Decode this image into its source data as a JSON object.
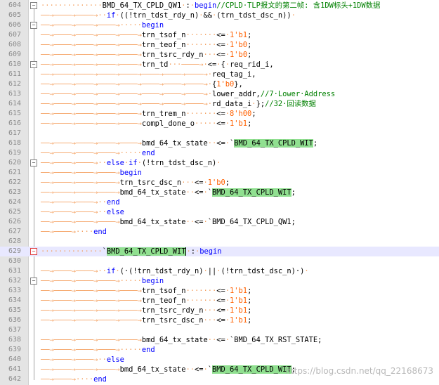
{
  "editor": {
    "watermark": "https://blog.csdn.net/qq_22168673",
    "lines": [
      {
        "n": "604",
        "fold": "minus",
        "segs": [
          [
            "ws",
            "··············"
          ],
          [
            "t",
            "BMD_64_TX_CPLD_QW1"
          ],
          [
            "ws",
            "·"
          ],
          [
            "op",
            ":"
          ],
          [
            "ws",
            "·"
          ],
          [
            "kw",
            "begin"
          ],
          [
            "cmt",
            "//CPLD·TLP报文的第二帧: 含1DW标头+1DW数据"
          ]
        ]
      },
      {
        "n": "605",
        "fold": "",
        "segs": [
          [
            "ws",
            "──→────→────→··"
          ],
          [
            "kw",
            "if"
          ],
          [
            "ws",
            "·"
          ],
          [
            "op",
            "((!trn_tdst_rdy_n)"
          ],
          [
            "ws",
            "·"
          ],
          [
            "op",
            "&&"
          ],
          [
            "ws",
            "·"
          ],
          [
            "op",
            "(trn_tdst_dsc_n))"
          ],
          [
            "ws",
            "·"
          ]
        ]
      },
      {
        "n": "606",
        "fold": "minus",
        "segs": [
          [
            "ws",
            "──→────→────→────→·····"
          ],
          [
            "kw",
            "begin"
          ]
        ]
      },
      {
        "n": "607",
        "fold": "",
        "segs": [
          [
            "ws",
            "──→────→────→────→────→"
          ],
          [
            "t",
            "trn_tsof_n"
          ],
          [
            "ws",
            "·······"
          ],
          [
            "op",
            "<="
          ],
          [
            "ws",
            "·"
          ],
          [
            "num",
            "1'b1"
          ],
          [
            "op",
            ";"
          ]
        ]
      },
      {
        "n": "608",
        "fold": "",
        "segs": [
          [
            "ws",
            "──→────→────→────→────→"
          ],
          [
            "t",
            "trn_teof_n"
          ],
          [
            "ws",
            "·······"
          ],
          [
            "op",
            "<="
          ],
          [
            "ws",
            "·"
          ],
          [
            "num",
            "1'b0"
          ],
          [
            "op",
            ";"
          ]
        ]
      },
      {
        "n": "609",
        "fold": "",
        "segs": [
          [
            "ws",
            "──→────→────→────→────→"
          ],
          [
            "t",
            "trn_tsrc_rdy_n"
          ],
          [
            "ws",
            "···"
          ],
          [
            "op",
            "<="
          ],
          [
            "ws",
            "·"
          ],
          [
            "num",
            "1'b0"
          ],
          [
            "op",
            ";"
          ]
        ]
      },
      {
        "n": "610",
        "fold": "minus",
        "segs": [
          [
            "ws",
            "──→────→────→────→────→"
          ],
          [
            "t",
            "trn_td"
          ],
          [
            "ws",
            "···────→·"
          ],
          [
            "op",
            "<="
          ],
          [
            "ws",
            "·"
          ],
          [
            "op",
            "{"
          ],
          [
            "ws",
            "·"
          ],
          [
            "t",
            "req_rid_i,"
          ]
        ]
      },
      {
        "n": "611",
        "fold": "",
        "segs": [
          [
            "ws",
            "──→────→────→────→────→────→────→────→·"
          ],
          [
            "t",
            "req_tag_i,"
          ]
        ]
      },
      {
        "n": "612",
        "fold": "",
        "segs": [
          [
            "ws",
            "──→────→────→────→────→────→────→────→·"
          ],
          [
            "op",
            "{"
          ],
          [
            "num",
            "1'b0"
          ],
          [
            "op",
            "},"
          ]
        ]
      },
      {
        "n": "613",
        "fold": "",
        "segs": [
          [
            "ws",
            "──→────→────→────→────→────→────→────→·"
          ],
          [
            "t",
            "lower_addr,"
          ],
          [
            "cmt",
            "//7·Lower·Address"
          ]
        ]
      },
      {
        "n": "614",
        "fold": "",
        "segs": [
          [
            "ws",
            "──→────→────→────→────→────→────→────→·"
          ],
          [
            "t",
            "rd_data_i"
          ],
          [
            "ws",
            "·"
          ],
          [
            "op",
            "};"
          ],
          [
            "cmt",
            "//32·回读数据"
          ]
        ]
      },
      {
        "n": "615",
        "fold": "",
        "segs": [
          [
            "ws",
            "──→────→────→────→────→"
          ],
          [
            "t",
            "trn_trem_n"
          ],
          [
            "ws",
            "·······"
          ],
          [
            "op",
            "<="
          ],
          [
            "ws",
            "·"
          ],
          [
            "num",
            "8'h00"
          ],
          [
            "op",
            ";"
          ]
        ]
      },
      {
        "n": "616",
        "fold": "",
        "segs": [
          [
            "ws",
            "──→────→────→────→────→"
          ],
          [
            "t",
            "compl_done_o"
          ],
          [
            "ws",
            "·····"
          ],
          [
            "op",
            "<="
          ],
          [
            "ws",
            "·"
          ],
          [
            "num",
            "1'b1"
          ],
          [
            "op",
            ";"
          ]
        ]
      },
      {
        "n": "617",
        "fold": "",
        "segs": []
      },
      {
        "n": "618",
        "fold": "",
        "segs": [
          [
            "ws",
            "──→────→────→────→────→"
          ],
          [
            "t",
            "bmd_64_tx_state"
          ],
          [
            "ws",
            "··"
          ],
          [
            "op",
            "<="
          ],
          [
            "ws",
            "·"
          ],
          [
            "t",
            "`"
          ],
          [
            "hl",
            "BMD_64_TX_CPLD_WIT"
          ],
          [
            "op",
            ";"
          ]
        ]
      },
      {
        "n": "619",
        "fold": "",
        "segs": [
          [
            "ws",
            "──→────→────→────→·····"
          ],
          [
            "kw",
            "end"
          ]
        ]
      },
      {
        "n": "620",
        "fold": "minus",
        "segs": [
          [
            "ws",
            "──→────→────→··"
          ],
          [
            "kw",
            "else"
          ],
          [
            "ws",
            "·"
          ],
          [
            "kw",
            "if"
          ],
          [
            "ws",
            "·"
          ],
          [
            "op",
            "(!trn_tdst_dsc_n)"
          ],
          [
            "ws",
            "·"
          ]
        ]
      },
      {
        "n": "621",
        "fold": "",
        "segs": [
          [
            "ws",
            "──→────→────→────→"
          ],
          [
            "kw",
            "begin"
          ]
        ]
      },
      {
        "n": "622",
        "fold": "",
        "segs": [
          [
            "ws",
            "──→────→────→────→"
          ],
          [
            "t",
            "trn_tsrc_dsc_n"
          ],
          [
            "ws",
            "···"
          ],
          [
            "op",
            "<="
          ],
          [
            "ws",
            "·"
          ],
          [
            "num",
            "1'b0"
          ],
          [
            "op",
            ";"
          ]
        ]
      },
      {
        "n": "623",
        "fold": "",
        "segs": [
          [
            "ws",
            "──→────→────→────→"
          ],
          [
            "t",
            "bmd_64_tx_state"
          ],
          [
            "ws",
            "··"
          ],
          [
            "op",
            "<="
          ],
          [
            "ws",
            "·"
          ],
          [
            "t",
            "`"
          ],
          [
            "hl",
            "BMD_64_TX_CPLD_WIT"
          ],
          [
            "op",
            ";"
          ]
        ]
      },
      {
        "n": "624",
        "fold": "",
        "segs": [
          [
            "ws",
            "──→────→────→··"
          ],
          [
            "kw",
            "end"
          ]
        ]
      },
      {
        "n": "625",
        "fold": "",
        "segs": [
          [
            "ws",
            "──→────→────→··"
          ],
          [
            "kw",
            "else"
          ]
        ]
      },
      {
        "n": "626",
        "fold": "",
        "segs": [
          [
            "ws",
            "──→────→────→────→"
          ],
          [
            "t",
            "bmd_64_tx_state"
          ],
          [
            "ws",
            "··"
          ],
          [
            "op",
            "<="
          ],
          [
            "ws",
            "·"
          ],
          [
            "t",
            "`BMD_64_TX_CPLD_QW1"
          ],
          [
            "op",
            ";"
          ]
        ]
      },
      {
        "n": "627",
        "fold": "",
        "segs": [
          [
            "ws",
            "──→────→····"
          ],
          [
            "kw",
            "end"
          ]
        ]
      },
      {
        "n": "628",
        "fold": "",
        "segs": []
      },
      {
        "n": "629",
        "fold": "red",
        "current": true,
        "segs": [
          [
            "ws",
            "··············"
          ],
          [
            "t",
            "`"
          ],
          [
            "hl",
            "BMD_64_TX_CPLD_WIT"
          ],
          [
            "caret",
            ""
          ],
          [
            "ws",
            "·"
          ],
          [
            "op",
            ":"
          ],
          [
            "ws",
            "·"
          ],
          [
            "kw",
            "begin"
          ]
        ]
      },
      {
        "n": "630",
        "fold": "",
        "segs": []
      },
      {
        "n": "631",
        "fold": "",
        "segs": [
          [
            "ws",
            "──→────→────→··"
          ],
          [
            "kw",
            "if"
          ],
          [
            "ws",
            "·"
          ],
          [
            "op",
            "(·(!trn_tdst_rdy_n)"
          ],
          [
            "ws",
            "·"
          ],
          [
            "op",
            "||"
          ],
          [
            "ws",
            "·"
          ],
          [
            "op",
            "(!trn_tdst_dsc_n)·)"
          ],
          [
            "ws",
            "·"
          ]
        ]
      },
      {
        "n": "632",
        "fold": "minus",
        "segs": [
          [
            "ws",
            "──→────→────→────→·····"
          ],
          [
            "kw",
            "begin"
          ]
        ]
      },
      {
        "n": "633",
        "fold": "",
        "segs": [
          [
            "ws",
            "──→────→────→────→────→"
          ],
          [
            "t",
            "trn_tsof_n"
          ],
          [
            "ws",
            "·······"
          ],
          [
            "op",
            "<="
          ],
          [
            "ws",
            "·"
          ],
          [
            "num",
            "1'b1"
          ],
          [
            "op",
            ";"
          ]
        ]
      },
      {
        "n": "634",
        "fold": "",
        "segs": [
          [
            "ws",
            "──→────→────→────→────→"
          ],
          [
            "t",
            "trn_teof_n"
          ],
          [
            "ws",
            "·······"
          ],
          [
            "op",
            "<="
          ],
          [
            "ws",
            "·"
          ],
          [
            "num",
            "1'b1"
          ],
          [
            "op",
            ";"
          ]
        ]
      },
      {
        "n": "635",
        "fold": "",
        "segs": [
          [
            "ws",
            "──→────→────→────→────→"
          ],
          [
            "t",
            "trn_tsrc_rdy_n"
          ],
          [
            "ws",
            "···"
          ],
          [
            "op",
            "<="
          ],
          [
            "ws",
            "·"
          ],
          [
            "num",
            "1'b1"
          ],
          [
            "op",
            ";"
          ]
        ]
      },
      {
        "n": "636",
        "fold": "",
        "segs": [
          [
            "ws",
            "──→────→────→────→────→"
          ],
          [
            "t",
            "trn_tsrc_dsc_n"
          ],
          [
            "ws",
            "···"
          ],
          [
            "op",
            "<="
          ],
          [
            "ws",
            "·"
          ],
          [
            "num",
            "1'b1"
          ],
          [
            "op",
            ";"
          ]
        ]
      },
      {
        "n": "637",
        "fold": "",
        "segs": []
      },
      {
        "n": "638",
        "fold": "",
        "segs": [
          [
            "ws",
            "──→────→────→────→────→"
          ],
          [
            "t",
            "bmd_64_tx_state"
          ],
          [
            "ws",
            "··"
          ],
          [
            "op",
            "<="
          ],
          [
            "ws",
            "·"
          ],
          [
            "t",
            "`BMD_64_TX_RST_STATE"
          ],
          [
            "op",
            ";"
          ]
        ]
      },
      {
        "n": "639",
        "fold": "",
        "segs": [
          [
            "ws",
            "──→────→────→────→·····"
          ],
          [
            "kw",
            "end"
          ]
        ]
      },
      {
        "n": "640",
        "fold": "",
        "segs": [
          [
            "ws",
            "──→────→────→··"
          ],
          [
            "kw",
            "else"
          ]
        ]
      },
      {
        "n": "641",
        "fold": "",
        "segs": [
          [
            "ws",
            "──→────→────→────→"
          ],
          [
            "t",
            "bmd_64_tx_state"
          ],
          [
            "ws",
            "··"
          ],
          [
            "op",
            "<="
          ],
          [
            "ws",
            "·"
          ],
          [
            "t",
            "`"
          ],
          [
            "hl",
            "BMD_64_TX_CPLD_WIT"
          ],
          [
            "op",
            ";"
          ]
        ]
      },
      {
        "n": "642",
        "fold": "",
        "segs": [
          [
            "ws",
            "──→────→····"
          ],
          [
            "kw",
            "end"
          ]
        ]
      }
    ]
  }
}
